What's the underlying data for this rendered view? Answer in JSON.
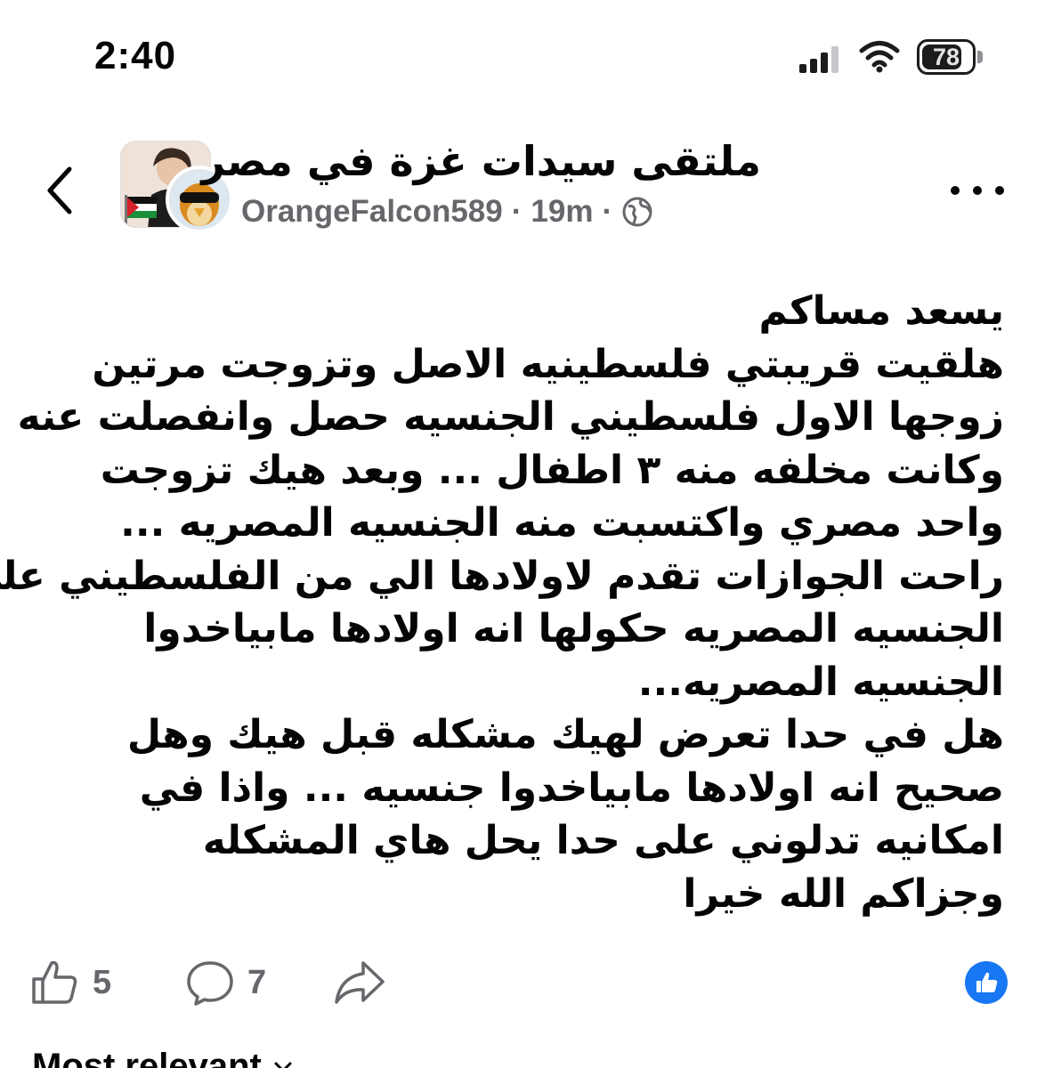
{
  "status_bar": {
    "time": "2:40",
    "battery_level": "78"
  },
  "header": {
    "group_name": "ملتقى سيدات غزة في مصر",
    "author": "OrangeFalcon589",
    "separator": "·",
    "time_ago": "19m",
    "privacy_icon": "globe-icon"
  },
  "post": {
    "lines": [
      "يسعد مساكم",
      "هلقيت قريبتي فلسطينيه الاصل وتزوجت مرتين",
      " زوجها الاول فلسطيني الجنسيه حصل وانفصلت عنه",
      "وكانت مخلفه منه ٣ اطفال ... وبعد هيك تزوجت",
      "واحد مصري واكتسبت منه الجنسيه المصريه ...",
      "راحت الجوازات تقدم لاولادها الي من الفلسطيني على",
      "الجنسيه المصريه حكولها انه اولادها مابياخدوا",
      "الجنسيه المصريه...",
      "هل في حدا تعرض لهيك مشكله قبل هيك وهل",
      "صحيح انه اولادها مابياخدوا جنسيه ... واذا في",
      "امكانيه تدلوني على حدا يحل هاي المشكله",
      "وجزاكم الله خيرا"
    ]
  },
  "actions": {
    "likes": "5",
    "comments": "7"
  },
  "comments_section": {
    "sort_label": "Most relevant"
  },
  "colors": {
    "text": "#050505",
    "secondary": "#65676b",
    "brand_blue": "#1877f2"
  }
}
